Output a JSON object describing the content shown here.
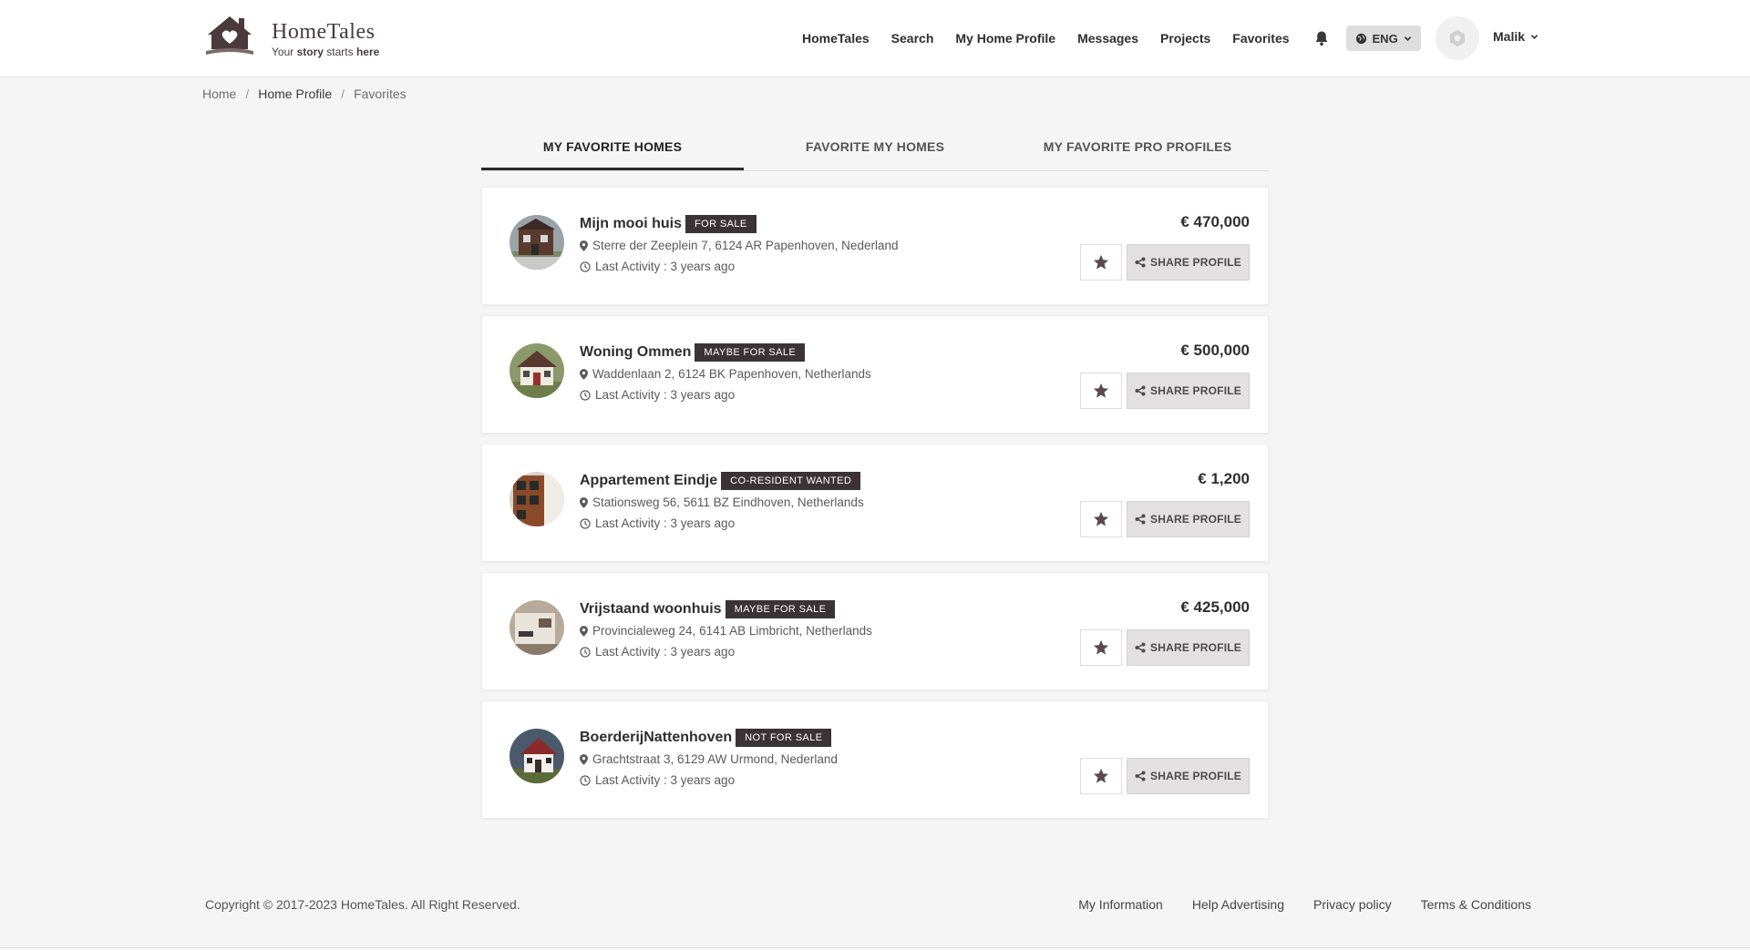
{
  "brand": {
    "name": "HomeTales",
    "tagline_pre": "Your",
    "tagline_bold1": "story",
    "tagline_mid": "starts",
    "tagline_bold2": "here"
  },
  "nav": {
    "items": [
      "HomeTales",
      "Search",
      "My Home Profile",
      "Messages",
      "Projects",
      "Favorites"
    ],
    "language": "ENG",
    "user_name": "Malik"
  },
  "breadcrumb": [
    "Home",
    "Home Profile",
    "Favorites"
  ],
  "tabs": [
    "MY FAVORITE HOMES",
    "FAVORITE MY HOMES",
    "MY FAVORITE PRO PROFILES"
  ],
  "active_tab": 0,
  "share_label": "SHARE PROFILE",
  "favorites": [
    {
      "name": "Mijn mooi huis",
      "badge": "FOR SALE",
      "address": "Sterre der Zeeplein 7, 6124 AR Papenhoven, Nederland",
      "activity": "Last Activity : 3 years ago",
      "price": "€ 470,000"
    },
    {
      "name": "Woning Ommen",
      "badge": "MAYBE FOR SALE",
      "address": "Waddenlaan 2, 6124 BK Papenhoven, Netherlands",
      "activity": "Last Activity : 3 years ago",
      "price": "€ 500,000"
    },
    {
      "name": "Appartement Eindje",
      "badge": "CO-RESIDENT WANTED",
      "address": "Stationsweg 56, 5611 BZ Eindhoven, Netherlands",
      "activity": "Last Activity : 3 years ago",
      "price": "€ 1,200"
    },
    {
      "name": "Vrijstaand woonhuis",
      "badge": "MAYBE FOR SALE",
      "address": "Provincialeweg 24, 6141 AB Limbricht, Netherlands",
      "activity": "Last Activity : 3 years ago",
      "price": "€ 425,000"
    },
    {
      "name": "BoerderijNattenhoven",
      "badge": "NOT FOR SALE",
      "address": "Grachtstraat 3, 6129 AW Urmond, Nederland",
      "activity": "Last Activity : 3 years ago",
      "price": ""
    }
  ],
  "footer": {
    "copyright": "Copyright © 2017-2023 HomeTales. All Right Reserved.",
    "links": [
      "My Information",
      "Help Advertising",
      "Privacy policy",
      "Terms & Conditions"
    ]
  },
  "colors": {
    "badge_bg": "#3b3336",
    "brand_dark": "#4a3a3c",
    "button_gray": "#e2e0e0"
  }
}
